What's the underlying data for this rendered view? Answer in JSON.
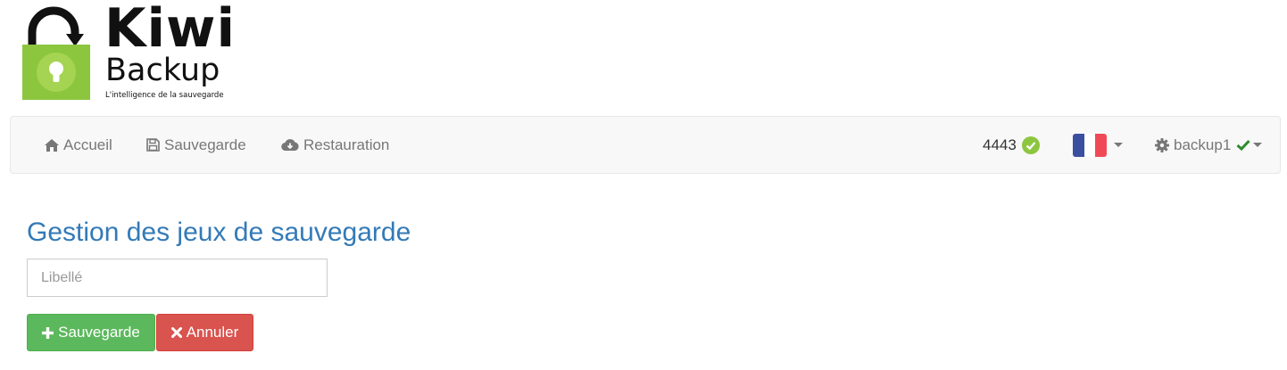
{
  "brand": {
    "name": "Kiwi",
    "subname": "Backup",
    "tagline": "L'intelligence de la sauvegarde",
    "logo_green": "#8cc63f",
    "logo_dark": "#111111"
  },
  "navbar": {
    "items": [
      {
        "label": "Accueil",
        "icon": "home-icon"
      },
      {
        "label": "Sauvegarde",
        "icon": "floppy-disk-icon"
      },
      {
        "label": "Restauration",
        "icon": "cloud-download-icon"
      }
    ],
    "count": "4443",
    "count_status_icon": "check-circle-icon",
    "language_flag": "fr",
    "user": "backup1",
    "user_status_icon": "check-icon"
  },
  "page": {
    "title": "Gestion des jeux de sauvegarde",
    "label_placeholder": "Libellé",
    "label_value": ""
  },
  "actions": {
    "save_label": "Sauvegarde",
    "cancel_label": "Annuler"
  },
  "colors": {
    "title": "#337ab7",
    "success": "#5cb85c",
    "danger": "#d9534f",
    "status_ok": "#8cc63f",
    "check": "#2e8b2e"
  }
}
